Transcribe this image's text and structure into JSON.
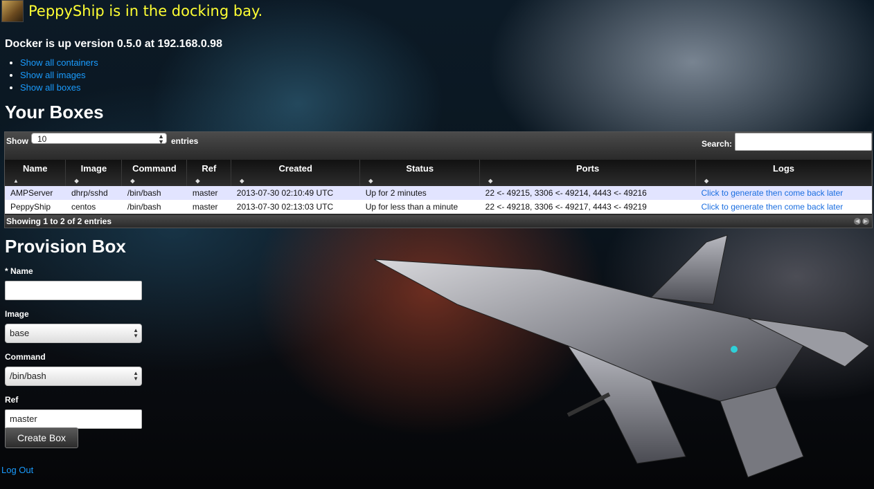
{
  "header": {
    "title": "PeppyShip is in the docking bay."
  },
  "docker_status": "Docker is up version 0.5.0 at 192.168.0.98",
  "links": [
    "Show all containers",
    "Show all images",
    "Show all boxes"
  ],
  "boxes": {
    "heading": "Your Boxes",
    "show_label": "Show",
    "length_value": "10",
    "entries_label": "entries",
    "search_label": "Search:",
    "columns": [
      "Name",
      "Image",
      "Command",
      "Ref",
      "Created",
      "Status",
      "Ports",
      "Logs"
    ],
    "rows": [
      {
        "name": "AMPServer",
        "image": "dhrp/sshd",
        "command": "/bin/bash",
        "ref": "master",
        "created": "2013-07-30 02:10:49 UTC",
        "status": "Up for 2 minutes",
        "ports": "22 <- 49215, 3306 <- 49214, 4443 <- 49216",
        "logs": "Click to generate then come back later"
      },
      {
        "name": "PeppyShip",
        "image": "centos",
        "command": "/bin/bash",
        "ref": "master",
        "created": "2013-07-30 02:13:03 UTC",
        "status": "Up for less than a minute",
        "ports": "22 <- 49218, 3306 <- 49217, 4443 <- 49219",
        "logs": "Click to generate then come back later"
      }
    ],
    "info": "Showing 1 to 2 of 2 entries"
  },
  "provision": {
    "heading": "Provision Box",
    "name_label": "* Name",
    "name_value": "",
    "image_label": "Image",
    "image_value": "base",
    "command_label": "Command",
    "command_value": "/bin/bash",
    "ref_label": "Ref",
    "ref_value": "master",
    "create_label": "Create Box"
  },
  "logout_label": "Log Out"
}
